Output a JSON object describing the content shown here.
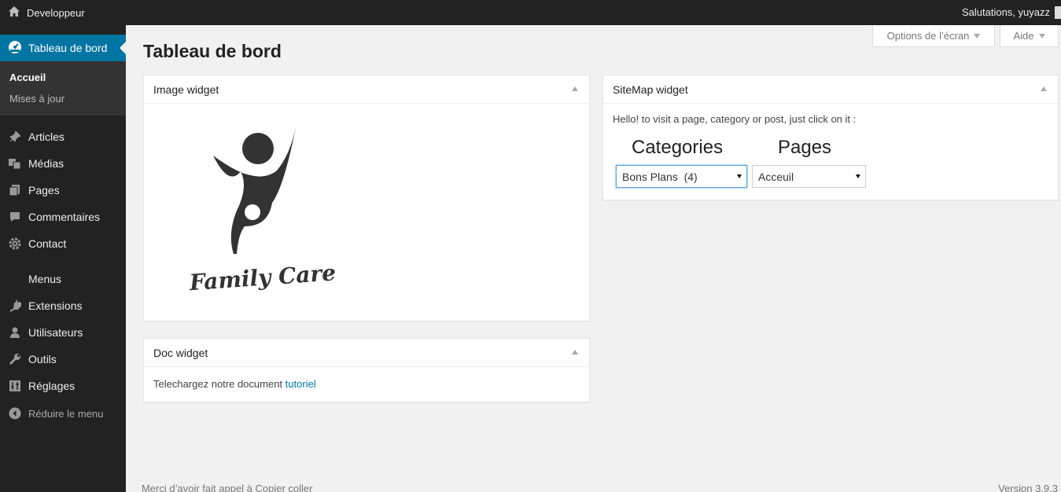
{
  "adminbar": {
    "site_name": "Developpeur",
    "greeting": "Salutations, yuyazz"
  },
  "sidebar": {
    "current": {
      "label": "Tableau de bord",
      "icon": "dashboard-icon"
    },
    "submenu": [
      "Accueil",
      "Mises à jour"
    ],
    "items": [
      {
        "label": "Articles",
        "icon": "pin-icon"
      },
      {
        "label": "Médias",
        "icon": "media-icon"
      },
      {
        "label": "Pages",
        "icon": "pages-icon"
      },
      {
        "label": "Commentaires",
        "icon": "comment-icon"
      },
      {
        "label": "Contact",
        "icon": "gear-icon"
      },
      {
        "label": "Menus",
        "icon": ""
      },
      {
        "label": "Extensions",
        "icon": "plug-icon"
      },
      {
        "label": "Utilisateurs",
        "icon": "user-icon"
      },
      {
        "label": "Outils",
        "icon": "wrench-icon"
      },
      {
        "label": "Réglages",
        "icon": "settings-icon"
      }
    ],
    "collapse_label": "Réduire le menu"
  },
  "screen_meta": {
    "options_label": "Options de l’écran",
    "help_label": "Aide"
  },
  "page": {
    "title": "Tableau de bord"
  },
  "widgets": {
    "image": {
      "title": "Image widget",
      "logo_text": "Family Care"
    },
    "doc": {
      "title": "Doc widget",
      "text": "Telechargez notre document",
      "link": "tutoriel"
    },
    "sitemap": {
      "title": "SiteMap widget",
      "intro": "Hello! to visit a page, category or post, just click on it :",
      "categories_title": "Categories",
      "pages_title": "Pages",
      "categories_selected": "Bons Plans  (4)",
      "pages_selected": "Acceuil"
    }
  },
  "footer": {
    "left": "Merci d’avoir fait appel à Copier coller",
    "right": "Version 3.9.3"
  },
  "colors": {
    "adminbar": "#222222",
    "accent": "#0074a2",
    "background": "#f1f1f1"
  }
}
